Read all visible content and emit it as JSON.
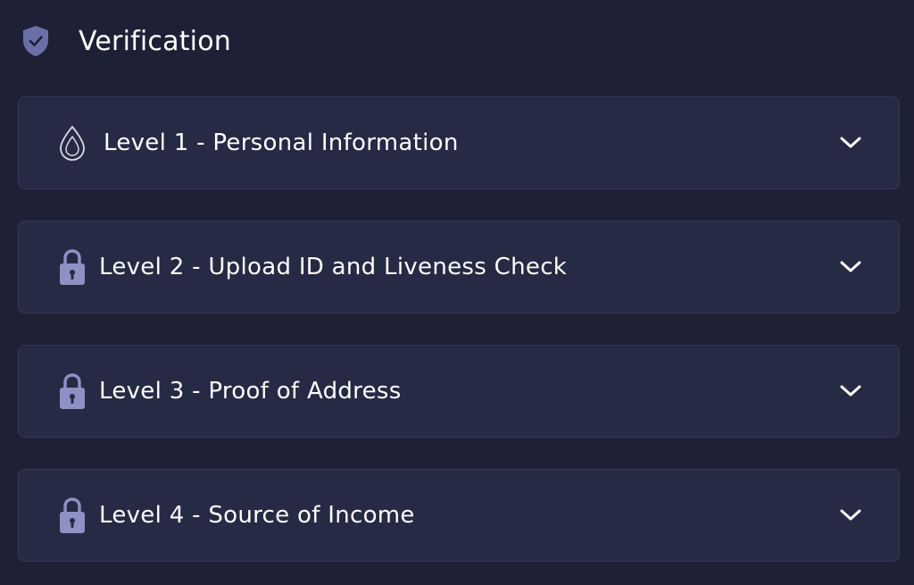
{
  "header": {
    "title": "Verification",
    "icon": "shield-check-icon"
  },
  "levels": [
    {
      "label": "Level 1 - Personal Information",
      "icon": "drop-icon",
      "state": "current"
    },
    {
      "label": "Level 2 - Upload ID and Liveness Check",
      "icon": "lock-icon",
      "state": "locked"
    },
    {
      "label": "Level 3 - Proof of Address",
      "icon": "lock-icon",
      "state": "locked"
    },
    {
      "label": "Level 4 - Source of Income",
      "icon": "lock-icon",
      "state": "locked"
    }
  ],
  "colors": {
    "background": "#1e2136",
    "panel": "#262a44",
    "panel_border": "#343955",
    "accent": "#6b6fa8",
    "text": "#ffffff"
  }
}
